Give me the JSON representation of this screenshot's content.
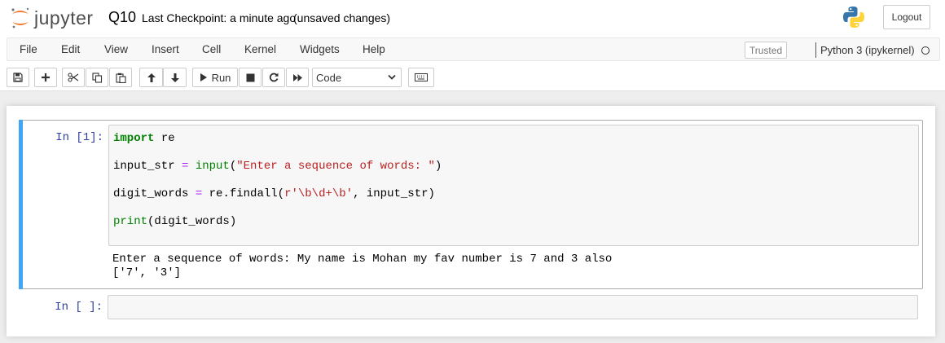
{
  "header": {
    "logo_text": "jupyter",
    "notebook_name": "Q10",
    "checkpoint": "Last Checkpoint: a minute ago",
    "autosave": "(unsaved changes)",
    "logout_label": "Logout"
  },
  "menubar": {
    "items": [
      "File",
      "Edit",
      "View",
      "Insert",
      "Cell",
      "Kernel",
      "Widgets",
      "Help"
    ],
    "trusted_label": "Trusted",
    "kernel_name": "Python 3 (ipykernel)"
  },
  "toolbar": {
    "run_label": "Run",
    "cell_type": "Code"
  },
  "cells": [
    {
      "prompt": "In [1]:",
      "code": {
        "l1": {
          "kw": "import",
          "rest": " re"
        },
        "l2": {
          "a": "input_str ",
          "op": "=",
          "b": " ",
          "fn": "input",
          "c": "(",
          "str": "\"Enter a sequence of words: \"",
          "d": ")"
        },
        "l3": {
          "a": "digit_words ",
          "op": "=",
          "b": " re.findall(",
          "str": "r'\\b\\d+\\b'",
          "c": ", input_str)"
        },
        "l4": {
          "fn": "print",
          "rest": "(digit_words)"
        }
      },
      "output": [
        "Enter a sequence of words: My name is Mohan my fav number is 7 and 3 also",
        "['7', '3']"
      ]
    },
    {
      "prompt": "In [ ]:"
    }
  ],
  "colors": {
    "selected_cell_bar": "#42a5f5",
    "prompt": "#303f9f",
    "keyword": "#008000",
    "string": "#ba2121",
    "operator": "#aa22ff"
  }
}
